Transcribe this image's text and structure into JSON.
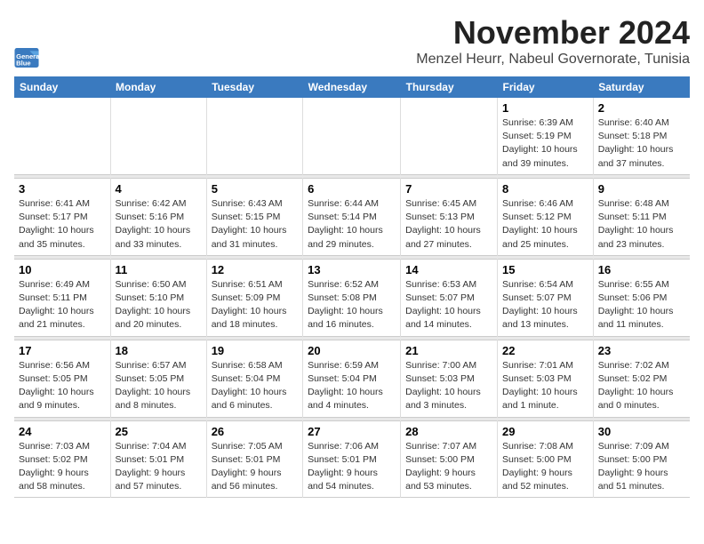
{
  "app": {
    "logo_line1": "General",
    "logo_line2": "Blue"
  },
  "header": {
    "month": "November 2024",
    "location": "Menzel Heurr, Nabeul Governorate, Tunisia"
  },
  "columns": [
    "Sunday",
    "Monday",
    "Tuesday",
    "Wednesday",
    "Thursday",
    "Friday",
    "Saturday"
  ],
  "weeks": [
    {
      "days": [
        {
          "num": "",
          "info": ""
        },
        {
          "num": "",
          "info": ""
        },
        {
          "num": "",
          "info": ""
        },
        {
          "num": "",
          "info": ""
        },
        {
          "num": "",
          "info": ""
        },
        {
          "num": "1",
          "info": "Sunrise: 6:39 AM\nSunset: 5:19 PM\nDaylight: 10 hours\nand 39 minutes."
        },
        {
          "num": "2",
          "info": "Sunrise: 6:40 AM\nSunset: 5:18 PM\nDaylight: 10 hours\nand 37 minutes."
        }
      ]
    },
    {
      "days": [
        {
          "num": "3",
          "info": "Sunrise: 6:41 AM\nSunset: 5:17 PM\nDaylight: 10 hours\nand 35 minutes."
        },
        {
          "num": "4",
          "info": "Sunrise: 6:42 AM\nSunset: 5:16 PM\nDaylight: 10 hours\nand 33 minutes."
        },
        {
          "num": "5",
          "info": "Sunrise: 6:43 AM\nSunset: 5:15 PM\nDaylight: 10 hours\nand 31 minutes."
        },
        {
          "num": "6",
          "info": "Sunrise: 6:44 AM\nSunset: 5:14 PM\nDaylight: 10 hours\nand 29 minutes."
        },
        {
          "num": "7",
          "info": "Sunrise: 6:45 AM\nSunset: 5:13 PM\nDaylight: 10 hours\nand 27 minutes."
        },
        {
          "num": "8",
          "info": "Sunrise: 6:46 AM\nSunset: 5:12 PM\nDaylight: 10 hours\nand 25 minutes."
        },
        {
          "num": "9",
          "info": "Sunrise: 6:48 AM\nSunset: 5:11 PM\nDaylight: 10 hours\nand 23 minutes."
        }
      ]
    },
    {
      "days": [
        {
          "num": "10",
          "info": "Sunrise: 6:49 AM\nSunset: 5:11 PM\nDaylight: 10 hours\nand 21 minutes."
        },
        {
          "num": "11",
          "info": "Sunrise: 6:50 AM\nSunset: 5:10 PM\nDaylight: 10 hours\nand 20 minutes."
        },
        {
          "num": "12",
          "info": "Sunrise: 6:51 AM\nSunset: 5:09 PM\nDaylight: 10 hours\nand 18 minutes."
        },
        {
          "num": "13",
          "info": "Sunrise: 6:52 AM\nSunset: 5:08 PM\nDaylight: 10 hours\nand 16 minutes."
        },
        {
          "num": "14",
          "info": "Sunrise: 6:53 AM\nSunset: 5:07 PM\nDaylight: 10 hours\nand 14 minutes."
        },
        {
          "num": "15",
          "info": "Sunrise: 6:54 AM\nSunset: 5:07 PM\nDaylight: 10 hours\nand 13 minutes."
        },
        {
          "num": "16",
          "info": "Sunrise: 6:55 AM\nSunset: 5:06 PM\nDaylight: 10 hours\nand 11 minutes."
        }
      ]
    },
    {
      "days": [
        {
          "num": "17",
          "info": "Sunrise: 6:56 AM\nSunset: 5:05 PM\nDaylight: 10 hours\nand 9 minutes."
        },
        {
          "num": "18",
          "info": "Sunrise: 6:57 AM\nSunset: 5:05 PM\nDaylight: 10 hours\nand 8 minutes."
        },
        {
          "num": "19",
          "info": "Sunrise: 6:58 AM\nSunset: 5:04 PM\nDaylight: 10 hours\nand 6 minutes."
        },
        {
          "num": "20",
          "info": "Sunrise: 6:59 AM\nSunset: 5:04 PM\nDaylight: 10 hours\nand 4 minutes."
        },
        {
          "num": "21",
          "info": "Sunrise: 7:00 AM\nSunset: 5:03 PM\nDaylight: 10 hours\nand 3 minutes."
        },
        {
          "num": "22",
          "info": "Sunrise: 7:01 AM\nSunset: 5:03 PM\nDaylight: 10 hours\nand 1 minute."
        },
        {
          "num": "23",
          "info": "Sunrise: 7:02 AM\nSunset: 5:02 PM\nDaylight: 10 hours\nand 0 minutes."
        }
      ]
    },
    {
      "days": [
        {
          "num": "24",
          "info": "Sunrise: 7:03 AM\nSunset: 5:02 PM\nDaylight: 9 hours\nand 58 minutes."
        },
        {
          "num": "25",
          "info": "Sunrise: 7:04 AM\nSunset: 5:01 PM\nDaylight: 9 hours\nand 57 minutes."
        },
        {
          "num": "26",
          "info": "Sunrise: 7:05 AM\nSunset: 5:01 PM\nDaylight: 9 hours\nand 56 minutes."
        },
        {
          "num": "27",
          "info": "Sunrise: 7:06 AM\nSunset: 5:01 PM\nDaylight: 9 hours\nand 54 minutes."
        },
        {
          "num": "28",
          "info": "Sunrise: 7:07 AM\nSunset: 5:00 PM\nDaylight: 9 hours\nand 53 minutes."
        },
        {
          "num": "29",
          "info": "Sunrise: 7:08 AM\nSunset: 5:00 PM\nDaylight: 9 hours\nand 52 minutes."
        },
        {
          "num": "30",
          "info": "Sunrise: 7:09 AM\nSunset: 5:00 PM\nDaylight: 9 hours\nand 51 minutes."
        }
      ]
    }
  ]
}
